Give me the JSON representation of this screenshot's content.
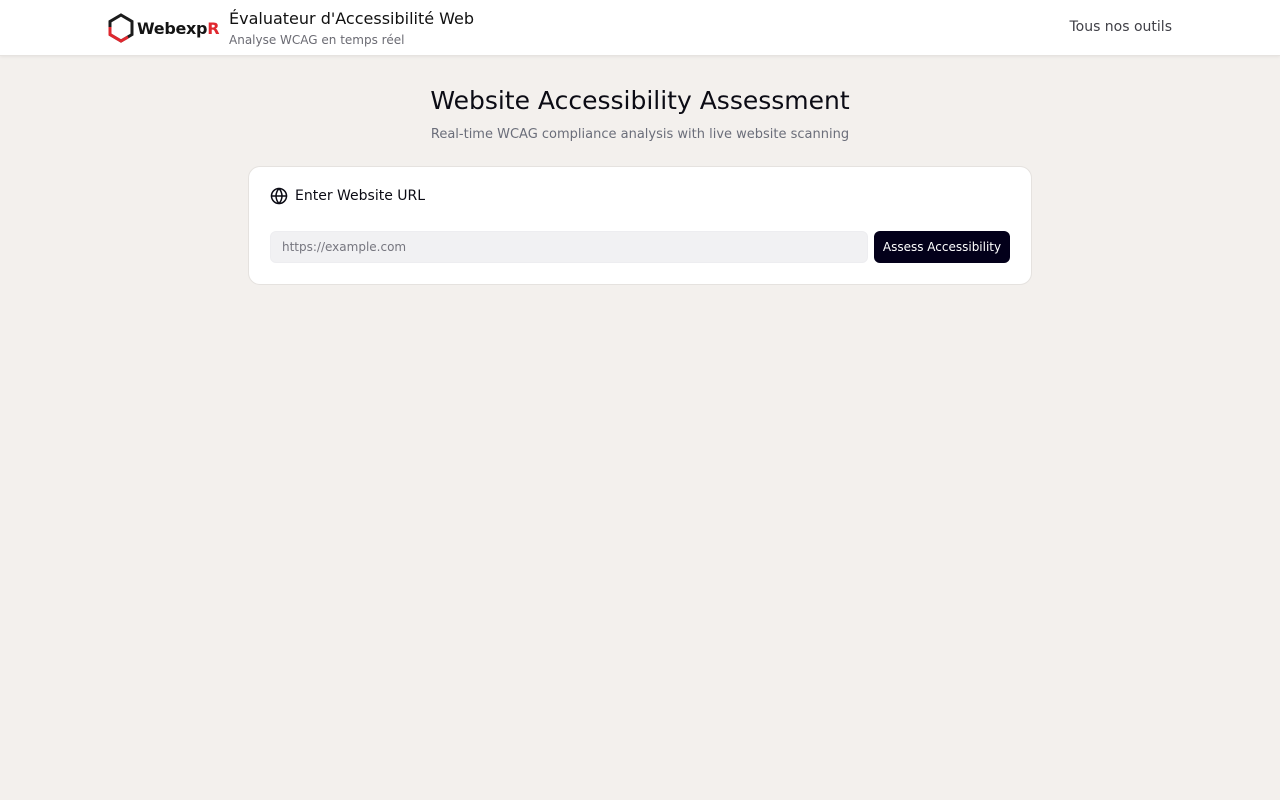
{
  "header": {
    "brand": {
      "name_main": "Webexp",
      "name_accent": "R"
    },
    "title": "Évaluateur d'Accessibilité Web",
    "subtitle": "Analyse WCAG en temps réel",
    "nav_link": "Tous nos outils"
  },
  "main": {
    "title": "Website Accessibility Assessment",
    "subtitle": "Real-time WCAG compliance analysis with live website scanning"
  },
  "card": {
    "icon": "globe-icon",
    "title": "Enter Website URL",
    "input": {
      "value": "",
      "placeholder": "https://example.com"
    },
    "button_label": "Assess Accessibility"
  },
  "colors": {
    "background": "#f3f0ed",
    "brand_accent": "#e0282f",
    "button_bg": "#03001a"
  }
}
